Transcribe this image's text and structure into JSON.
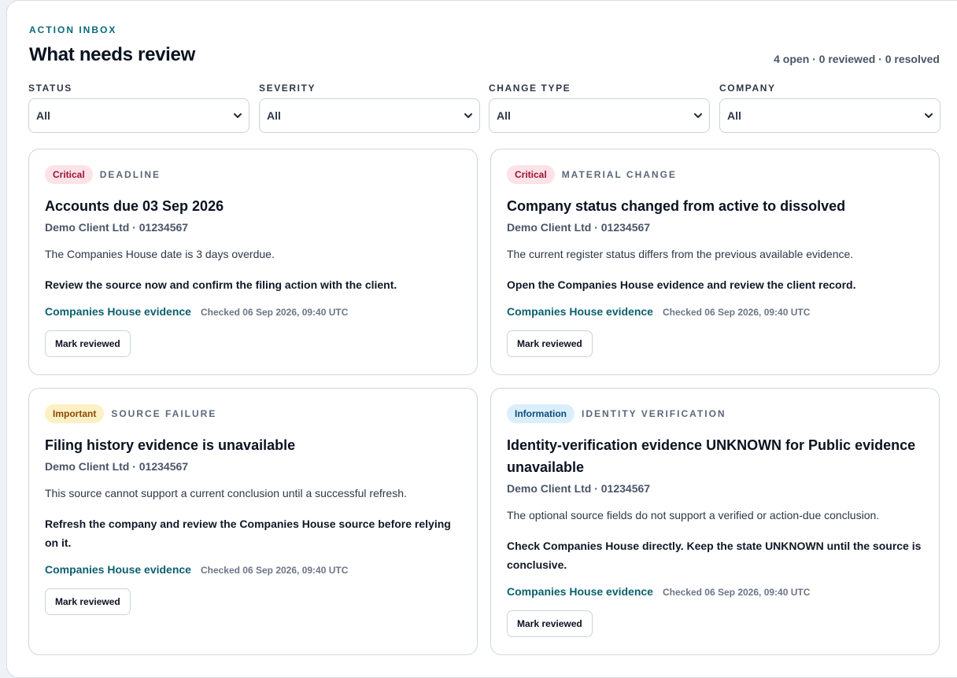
{
  "header": {
    "eyebrow": "ACTION INBOX",
    "title": "What needs review",
    "counts": "4 open · 0 reviewed · 0 resolved"
  },
  "filters": [
    {
      "label": "STATUS",
      "value": "All"
    },
    {
      "label": "SEVERITY",
      "value": "All"
    },
    {
      "label": "CHANGE TYPE",
      "value": "All"
    },
    {
      "label": "COMPANY",
      "value": "All"
    }
  ],
  "severity_colors": {
    "critical": "#9b1237",
    "important": "#8a4b06",
    "information": "#0b4f7a"
  },
  "cards": [
    {
      "severity": "Critical",
      "category": "DEADLINE",
      "title": "Accounts due 03 Sep 2026",
      "company": "Demo Client Ltd · 01234567",
      "description": "The Companies House date is 3 days overdue.",
      "action": "Review the source now and confirm the filing action with the client.",
      "evidence_link": "Companies House evidence",
      "checked": "Checked 06 Sep 2026, 09:40 UTC",
      "button": "Mark reviewed"
    },
    {
      "severity": "Critical",
      "category": "MATERIAL CHANGE",
      "title": "Company status changed from active to dissolved",
      "company": "Demo Client Ltd · 01234567",
      "description": "The current register status differs from the previous available evidence.",
      "action": "Open the Companies House evidence and review the client record.",
      "evidence_link": "Companies House evidence",
      "checked": "Checked 06 Sep 2026, 09:40 UTC",
      "button": "Mark reviewed"
    },
    {
      "severity": "Important",
      "category": "SOURCE FAILURE",
      "title": "Filing history evidence is unavailable",
      "company": "Demo Client Ltd · 01234567",
      "description": "This source cannot support a current conclusion until a successful refresh.",
      "action": "Refresh the company and review the Companies House source before relying on it.",
      "evidence_link": "Companies House evidence",
      "checked": "Checked 06 Sep 2026, 09:40 UTC",
      "button": "Mark reviewed"
    },
    {
      "severity": "Information",
      "category": "IDENTITY VERIFICATION",
      "title": "Identity-verification evidence UNKNOWN for Public evidence unavailable",
      "company": "Demo Client Ltd · 01234567",
      "description": "The optional source fields do not support a verified or action-due conclusion.",
      "action": "Check Companies House directly. Keep the state UNKNOWN until the source is conclusive.",
      "evidence_link": "Companies House evidence",
      "checked": "Checked 06 Sep 2026, 09:40 UTC",
      "button": "Mark reviewed"
    }
  ]
}
